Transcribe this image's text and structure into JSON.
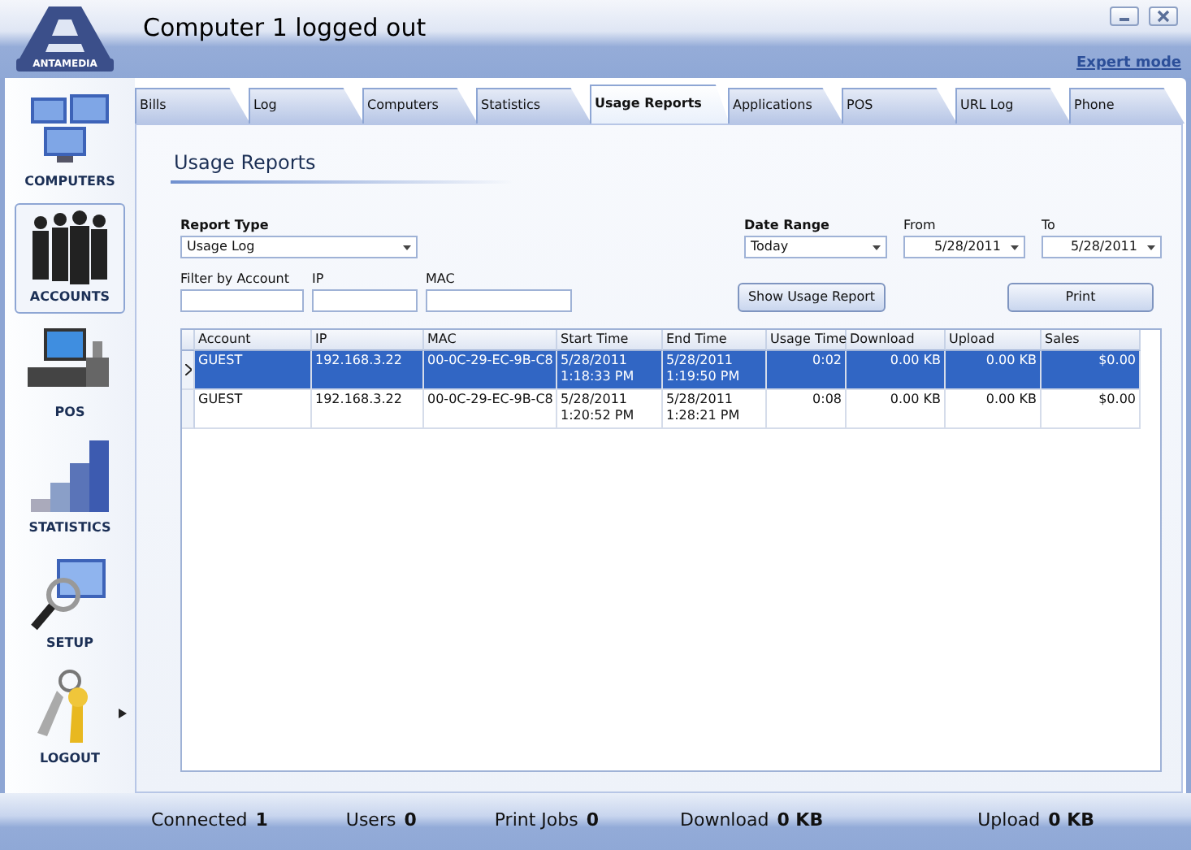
{
  "window": {
    "title": "Computer 1 logged out",
    "mode_link": "Expert mode",
    "logo_text": "ANTAMEDIA"
  },
  "sidebar": {
    "items": [
      {
        "label": "COMPUTERS",
        "selected": false
      },
      {
        "label": "ACCOUNTS",
        "selected": true
      },
      {
        "label": "POS",
        "selected": false
      },
      {
        "label": "STATISTICS",
        "selected": false
      },
      {
        "label": "SETUP",
        "selected": false
      },
      {
        "label": "LOGOUT",
        "selected": false
      }
    ]
  },
  "tabs": [
    {
      "label": "Bills",
      "selected": false
    },
    {
      "label": "Log",
      "selected": false
    },
    {
      "label": "Computers",
      "selected": false
    },
    {
      "label": "Statistics",
      "selected": false
    },
    {
      "label": "Usage Reports",
      "selected": true
    },
    {
      "label": "Applications",
      "selected": false
    },
    {
      "label": "POS",
      "selected": false
    },
    {
      "label": "URL Log",
      "selected": false
    },
    {
      "label": "Phone",
      "selected": false
    }
  ],
  "page_title": "Usage Reports",
  "filters": {
    "report_type": {
      "label": "Report Type",
      "value": "Usage Log"
    },
    "account": {
      "label": "Filter by Account"
    },
    "ip": {
      "label": "IP"
    },
    "mac": {
      "label": "MAC"
    },
    "date_range": {
      "label": "Date Range",
      "value": "Today"
    },
    "from": {
      "label": "From",
      "value": "5/28/2011"
    },
    "to": {
      "label": "To",
      "value": "5/28/2011"
    }
  },
  "buttons": [
    "Show Usage Report",
    "Print"
  ],
  "table": {
    "columns": [
      "Account",
      "IP",
      "MAC",
      "Start Time",
      "End Time",
      "Usage Time",
      "Download",
      "Upload",
      "Sales"
    ],
    "rows": [
      {
        "selected": true,
        "cells": [
          "GUEST",
          "192.168.3.22",
          "00-0C-29-EC-9B-C8",
          "5/28/2011\n1:18:33 PM",
          "5/28/2011\n1:19:50 PM",
          "0:02",
          "0.00 KB",
          "0.00 KB",
          "$0.00"
        ]
      },
      {
        "selected": false,
        "cells": [
          "GUEST",
          "192.168.3.22",
          "00-0C-29-EC-9B-C8",
          "5/28/2011\n1:20:52 PM",
          "5/28/2011\n1:28:21 PM",
          "0:08",
          "0.00 KB",
          "0.00 KB",
          "$0.00"
        ]
      }
    ]
  },
  "status_bar": [
    {
      "label": "Connected",
      "value": "1"
    },
    {
      "label": "Users",
      "value": "0"
    },
    {
      "label": "Print Jobs",
      "value": "0"
    },
    {
      "label": "Download",
      "value": "0 KB"
    },
    {
      "label": "Upload",
      "value": "0 KB"
    }
  ]
}
